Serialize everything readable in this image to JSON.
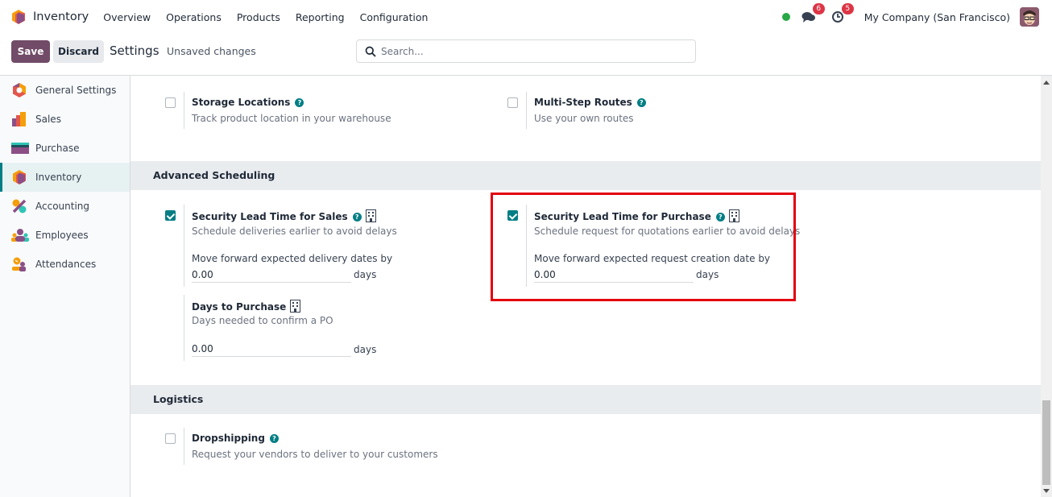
{
  "navbar": {
    "app_name": "Inventory",
    "menu": [
      "Overview",
      "Operations",
      "Products",
      "Reporting",
      "Configuration"
    ],
    "messages_badge": "6",
    "activities_badge": "5",
    "company": "My Company (San Francisco)",
    "presence_color": "#28a745"
  },
  "control_panel": {
    "save_label": "Save",
    "discard_label": "Discard",
    "title": "Settings",
    "status": "Unsaved changes",
    "search_placeholder": "Search..."
  },
  "sidebar": {
    "items": [
      {
        "label": "General Settings",
        "icon": "general-settings-icon",
        "active": false
      },
      {
        "label": "Sales",
        "icon": "sales-icon",
        "active": false
      },
      {
        "label": "Purchase",
        "icon": "purchase-icon",
        "active": false
      },
      {
        "label": "Inventory",
        "icon": "inventory-icon",
        "active": true
      },
      {
        "label": "Accounting",
        "icon": "accounting-icon",
        "active": false
      },
      {
        "label": "Employees",
        "icon": "employees-icon",
        "active": false
      },
      {
        "label": "Attendances",
        "icon": "attendances-icon",
        "active": false
      }
    ]
  },
  "settings": {
    "storage_locations": {
      "title": "Storage Locations",
      "desc": "Track product location in your warehouse",
      "checked": false
    },
    "multi_step_routes": {
      "title": "Multi-Step Routes",
      "desc": "Use your own routes",
      "checked": false
    },
    "advanced_scheduling": {
      "title": "Advanced Scheduling",
      "lead_sales": {
        "title": "Security Lead Time for Sales",
        "desc": "Schedule deliveries earlier to avoid delays",
        "label": "Move forward expected delivery dates by",
        "value": "0.00",
        "unit": "days",
        "checked": true
      },
      "lead_purchase": {
        "title": "Security Lead Time for Purchase",
        "desc": "Schedule request for quotations earlier to avoid delays",
        "label": "Move forward expected request creation date by",
        "value": "0.00",
        "unit": "days",
        "checked": true
      },
      "days_to_purchase": {
        "title": "Days to Purchase",
        "desc": "Days needed to confirm a PO",
        "value": "0.00",
        "unit": "days"
      }
    },
    "logistics": {
      "title": "Logistics",
      "dropshipping": {
        "title": "Dropshipping",
        "desc": "Request your vendors to deliver to your customers",
        "checked": false
      }
    }
  },
  "colors": {
    "brand": "#714b67",
    "accent": "#017e84",
    "highlight": "#e3000f"
  }
}
